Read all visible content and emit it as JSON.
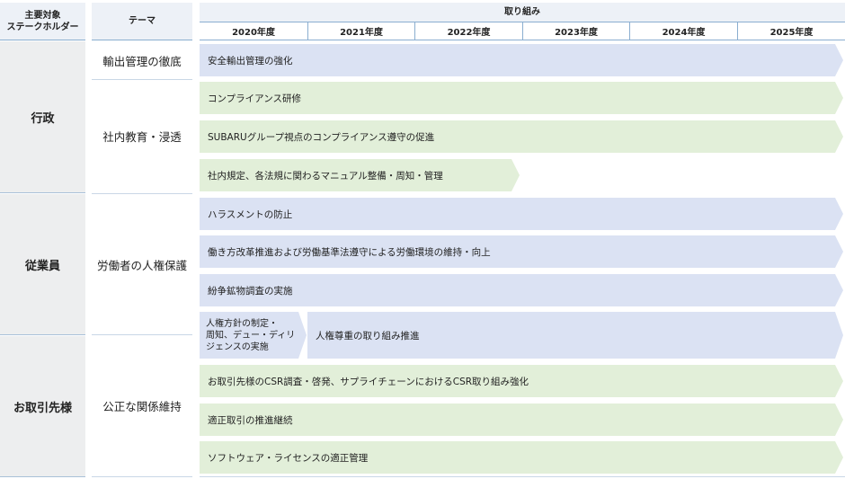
{
  "header": {
    "stakeholder": "主要対象\nステークホルダー",
    "theme": "テーマ",
    "initiatives": "取り組み",
    "years": [
      "2020年度",
      "2021年度",
      "2022年度",
      "2023年度",
      "2024年度",
      "2025年度"
    ]
  },
  "stakeholders": [
    "行政",
    "従業員",
    "お取引先様"
  ],
  "themes": [
    "輸出管理の徹底",
    "社内教育・浸透",
    "労働者の人権保護",
    "公正な関係維持"
  ],
  "initiatives": [
    "安全輸出管理の強化",
    "コンプライアンス研修",
    "SUBARUグループ視点のコンプライアンス遵守の促進",
    "社内規定、各法規に関わるマニュアル整備・周知・管理",
    "ハラスメントの防止",
    "働き方改革推進および労働基準法遵守による労働環境の維持・向上",
    "紛争鉱物調査の実施",
    "人権方針の制定・\n周知、デュー・ディリ\nジェンスの実施",
    "人権尊重の取り組み推進",
    "お取引先様のCSR調査・啓発、サプライチェーンにおけるCSR取り組み強化",
    "適正取引の推進継続",
    "ソフトウェア・ライセンスの適正管理"
  ],
  "colors": {
    "blue_bar": "#dbe2f3",
    "green_bar": "#e2efd9",
    "header_bg": "#edf1f7",
    "stakeholder_bg": "#edeeef"
  }
}
